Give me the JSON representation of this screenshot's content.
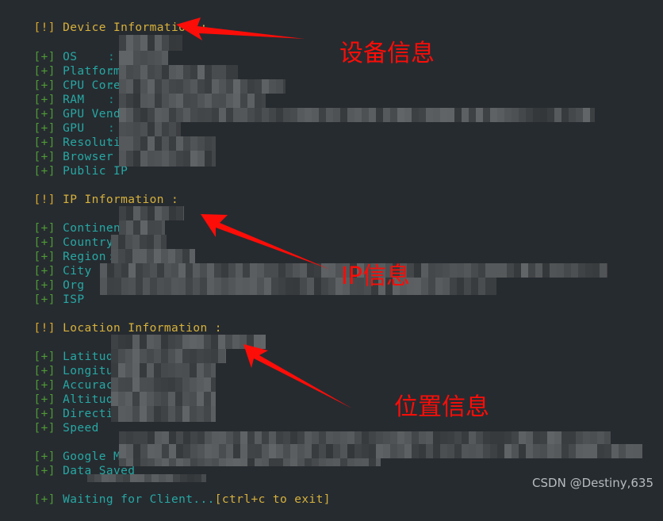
{
  "terminal": {
    "background_color": "#262b30",
    "header_color": "#d7b13a",
    "label_color": "#26a8a3",
    "ok_bracket_color": "#4f9b35",
    "warn_bracket_color": "#d9a82a",
    "annotation_color": "#fc0d08",
    "ok_prefix": "[+]",
    "warn_prefix": "[!]",
    "colon": ":",
    "sections": [
      {
        "id": "device-information",
        "header": "Device Information :",
        "rows": [
          {
            "label": "OS",
            "value": ""
          },
          {
            "label": "Platform",
            "value": ""
          },
          {
            "label": "CPU Cores",
            "value": ""
          },
          {
            "label": "RAM",
            "value": ""
          },
          {
            "label": "GPU Vendor",
            "value": ""
          },
          {
            "label": "GPU",
            "value": ""
          },
          {
            "label": "Resolution",
            "value": ""
          },
          {
            "label": "Browser",
            "value": ""
          },
          {
            "label": "Public IP",
            "value": ""
          }
        ]
      },
      {
        "id": "ip-information",
        "header": "IP Information :",
        "rows": [
          {
            "label": "Continent",
            "value": ""
          },
          {
            "label": "Country",
            "value": ""
          },
          {
            "label": "Region",
            "value": ""
          },
          {
            "label": "City",
            "value": ""
          },
          {
            "label": "Org",
            "value": ""
          },
          {
            "label": "ISP",
            "value": ""
          }
        ]
      },
      {
        "id": "location-information",
        "header": "Location Information :",
        "rows": [
          {
            "label": "Latitude",
            "value": ""
          },
          {
            "label": "Longitude",
            "value": ""
          },
          {
            "label": "Accuracy",
            "value": ""
          },
          {
            "label": "Altitude",
            "value": ""
          },
          {
            "label": "Direction",
            "value": ""
          },
          {
            "label": "Speed",
            "value": ""
          }
        ]
      },
      {
        "id": "output-information",
        "header": "",
        "rows": [
          {
            "label": "Google Maps",
            "value": ""
          },
          {
            "label": "Data Saved",
            "value": ""
          }
        ]
      }
    ],
    "status_line": {
      "prefix": "[+]",
      "message": "Waiting for Client...",
      "hint": "[ctrl+c to exit]"
    }
  },
  "annotations": [
    {
      "id": "device-annotation",
      "text": "设备信息"
    },
    {
      "id": "ip-annotation",
      "text": "IP信息"
    },
    {
      "id": "location-annotation",
      "text": "位置信息"
    }
  ],
  "watermark": {
    "text": "CSDN @Destiny,635"
  }
}
